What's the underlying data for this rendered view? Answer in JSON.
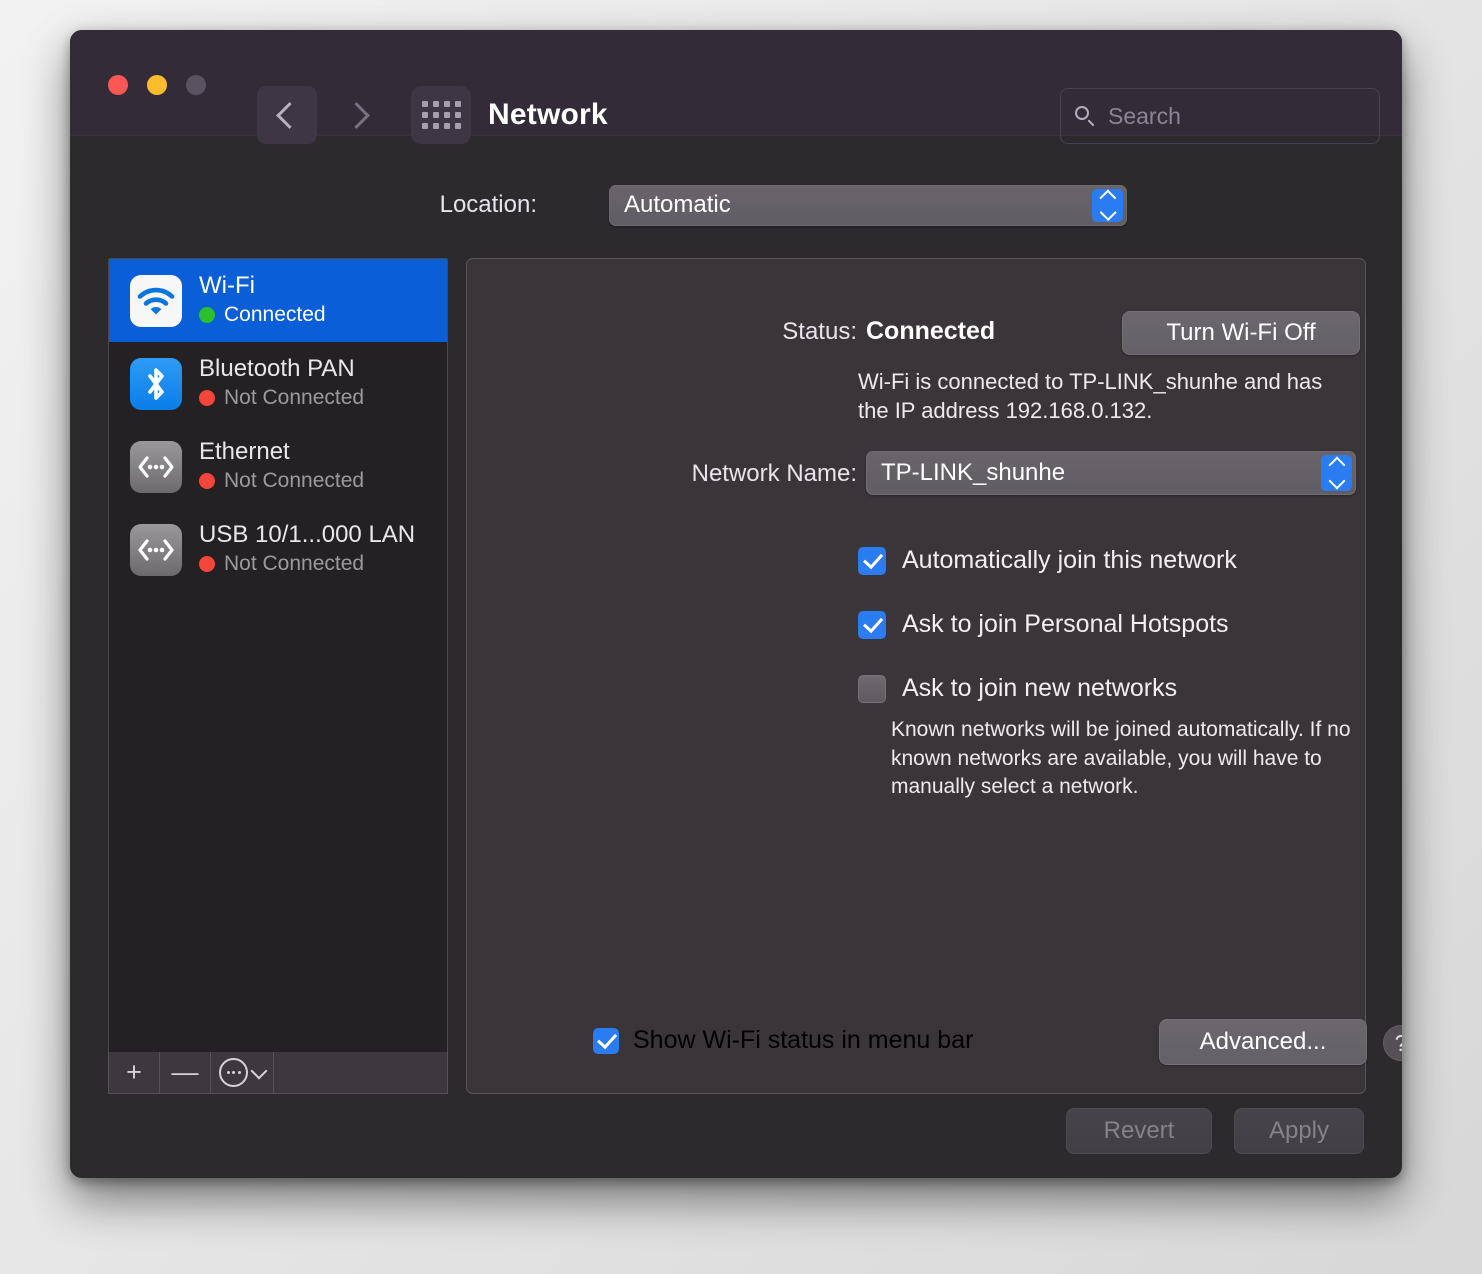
{
  "window": {
    "title": "Network",
    "traffic_lights": [
      "close",
      "minimize",
      "zoom"
    ],
    "back_icon": "chevron-left-icon",
    "forward_icon": "chevron-right-icon",
    "grid_icon": "show-all-grid-icon",
    "accent_color": "#2a7cf0",
    "titlebar_color": "#332b38",
    "body_color": "#2d2a2e"
  },
  "search": {
    "placeholder": "Search",
    "icon": "search-icon",
    "value": ""
  },
  "location": {
    "label": "Location:",
    "value": "Automatic",
    "options": [
      "Automatic"
    ]
  },
  "sidebar": {
    "services": [
      {
        "name": "Wi-Fi",
        "status": "Connected",
        "status_color": "#2cc02c",
        "icon": "wifi-icon",
        "selected": true
      },
      {
        "name": "Bluetooth PAN",
        "status": "Not Connected",
        "status_color": "#f4453c",
        "icon": "bluetooth-icon",
        "selected": false
      },
      {
        "name": "Ethernet",
        "status": "Not Connected",
        "status_color": "#f4453c",
        "icon": "ethernet-icon",
        "selected": false
      },
      {
        "name": "USB 10/1...000 LAN",
        "status": "Not Connected",
        "status_color": "#f4453c",
        "icon": "ethernet-icon",
        "selected": false
      }
    ],
    "toolbar": {
      "add_label": "+",
      "remove_label": "—",
      "action_icon": "circled-ellipsis-icon",
      "action_caret_icon": "chevron-down-icon"
    }
  },
  "panel": {
    "status_label": "Status:",
    "status_value": "Connected",
    "turn_off_button": "Turn Wi-Fi Off",
    "status_description": "Wi-Fi is connected to TP-LINK_shunhe and has the IP address 192.168.0.132.",
    "network_name_label": "Network Name:",
    "network_name_value": "TP-LINK_shunhe",
    "network_name_options": [
      "TP-LINK_shunhe"
    ],
    "checkboxes": [
      {
        "label": "Automatically join this network",
        "checked": true
      },
      {
        "label": "Ask to join Personal Hotspots",
        "checked": true
      },
      {
        "label": "Ask to join new networks",
        "checked": false
      }
    ],
    "hint": "Known networks will be joined automatically. If no known networks are available, you will have to manually select a network.",
    "show_status_checkbox": {
      "label": "Show Wi-Fi status in menu bar",
      "checked": true
    },
    "advanced_button": "Advanced...",
    "help_button": "?"
  },
  "footer": {
    "revert_button": "Revert",
    "apply_button": "Apply",
    "revert_enabled": false,
    "apply_enabled": false
  }
}
